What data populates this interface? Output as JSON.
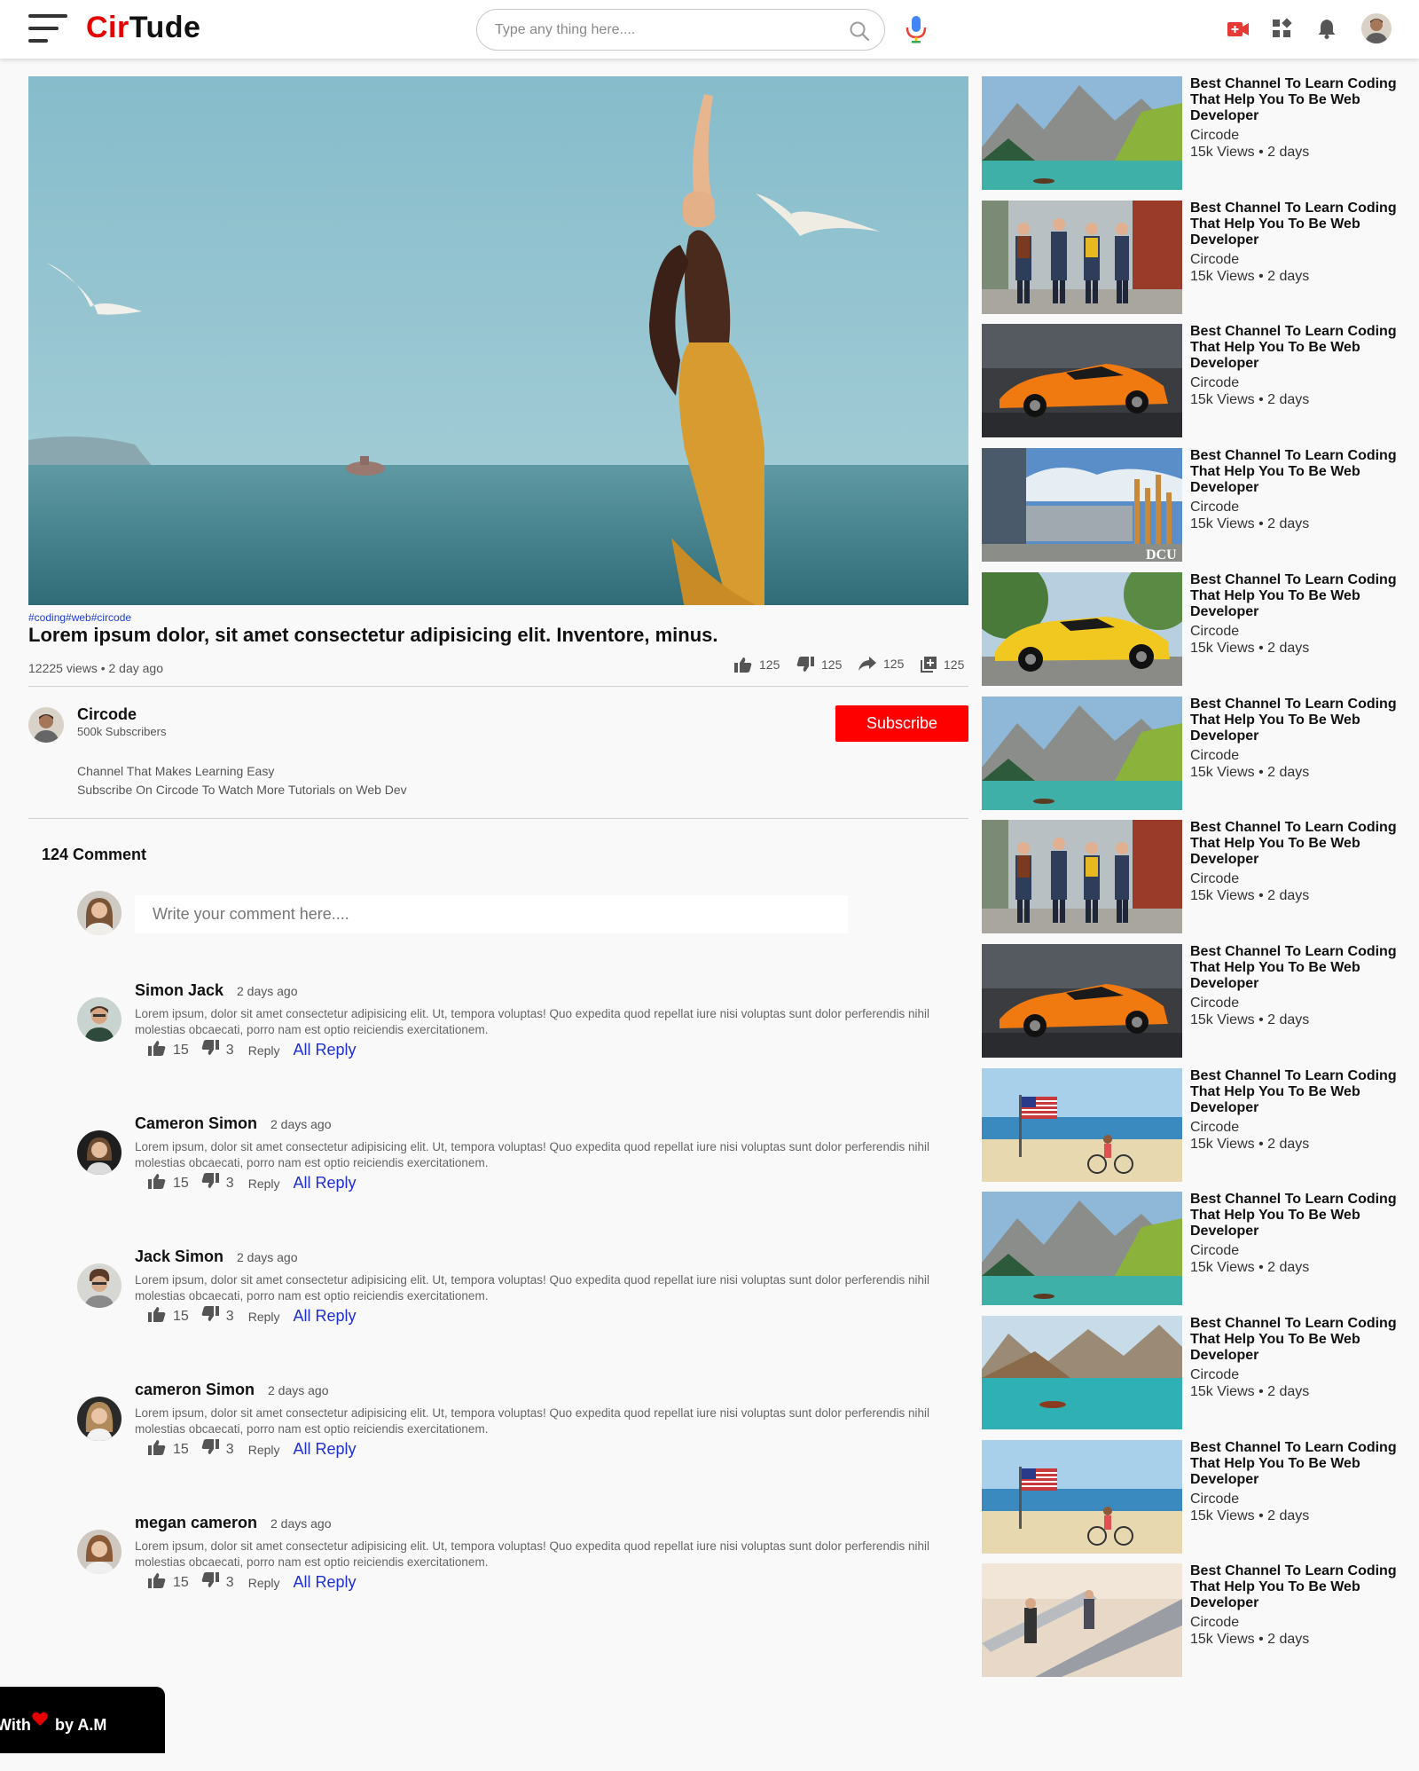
{
  "header": {
    "logo_part1": "Cir",
    "logo_part2": "Tude",
    "search_placeholder": "Type any thing here...."
  },
  "video": {
    "tags": "#coding#web#circode",
    "title": "Lorem ipsum dolor, sit amet consectetur adipisicing elit. Inventore, minus.",
    "meta": "12225 views • 2 day ago",
    "likes": "125",
    "dislikes": "125",
    "shares": "125",
    "saves": "125"
  },
  "channel": {
    "name": "Circode",
    "subscribers": "500k Subscribers",
    "subscribe_label": "Subscribe",
    "description_line1": "Channel That Makes Learning Easy",
    "description_line2": "Subscribe On Circode To Watch More Tutorials on Web Dev"
  },
  "comments_section": {
    "count_label": "124 Comment",
    "input_placeholder": "Write your comment here...."
  },
  "comments": [
    {
      "name": "Simon Jack",
      "time": "2 days ago",
      "text": "Lorem ipsum, dolor sit amet consectetur adipisicing elit. Ut, tempora voluptas! Quo expedita quod repellat iure nisi voluptas sunt dolor perferendis nihil molestias obcaecati, porro nam est optio reiciendis exercitationem.",
      "likes": "15",
      "dislikes": "3",
      "reply": "Reply",
      "all_reply": "All Reply"
    },
    {
      "name": "Cameron Simon",
      "time": "2 days ago",
      "text": "Lorem ipsum, dolor sit amet consectetur adipisicing elit. Ut, tempora voluptas! Quo expedita quod repellat iure nisi voluptas sunt dolor perferendis nihil molestias obcaecati, porro nam est optio reiciendis exercitationem.",
      "likes": "15",
      "dislikes": "3",
      "reply": "Reply",
      "all_reply": "All Reply"
    },
    {
      "name": "Jack Simon",
      "time": "2 days ago",
      "text": "Lorem ipsum, dolor sit amet consectetur adipisicing elit. Ut, tempora voluptas! Quo expedita quod repellat iure nisi voluptas sunt dolor perferendis nihil molestias obcaecati, porro nam est optio reiciendis exercitationem.",
      "likes": "15",
      "dislikes": "3",
      "reply": "Reply",
      "all_reply": "All Reply"
    },
    {
      "name": "cameron Simon",
      "time": "2 days ago",
      "text": "Lorem ipsum, dolor sit amet consectetur adipisicing elit. Ut, tempora voluptas! Quo expedita quod repellat iure nisi voluptas sunt dolor perferendis nihil molestias obcaecati, porro nam est optio reiciendis exercitationem.",
      "likes": "15",
      "dislikes": "3",
      "reply": "Reply",
      "all_reply": "All Reply"
    },
    {
      "name": "megan cameron",
      "time": "2 days ago",
      "text": "Lorem ipsum, dolor sit amet consectetur adipisicing elit. Ut, tempora voluptas! Quo expedita quod repellat iure nisi voluptas sunt dolor perferendis nihil molestias obcaecati, porro nam est optio reiciendis exercitationem.",
      "likes": "15",
      "dislikes": "3",
      "reply": "Reply",
      "all_reply": "All Reply"
    }
  ],
  "sidebar": [
    {
      "title": "Best Channel To Learn Coding That Help You To Be Web Developer",
      "channel": "Circode",
      "meta": "15k Views • 2 days",
      "thumb": "mountain-lake"
    },
    {
      "title": "Best Channel To Learn Coding That Help You To Be Web Developer",
      "channel": "Circode",
      "meta": "15k Views • 2 days",
      "thumb": "people-walking"
    },
    {
      "title": "Best Channel To Learn Coding That Help You To Be Web Developer",
      "channel": "Circode",
      "meta": "15k Views • 2 days",
      "thumb": "orange-car"
    },
    {
      "title": "Best Channel To Learn Coding That Help You To Be Web Developer",
      "channel": "Circode",
      "meta": "15k Views • 2 days",
      "thumb": "campus-building"
    },
    {
      "title": "Best Channel To Learn Coding That Help You To Be Web Developer",
      "channel": "Circode",
      "meta": "15k Views • 2 days",
      "thumb": "yellow-car"
    },
    {
      "title": "Best Channel To Learn Coding That Help You To Be Web Developer",
      "channel": "Circode",
      "meta": "15k Views • 2 days",
      "thumb": "mountain-lake"
    },
    {
      "title": "Best Channel To Learn Coding That Help You To Be Web Developer",
      "channel": "Circode",
      "meta": "15k Views • 2 days",
      "thumb": "people-walking"
    },
    {
      "title": "Best Channel To Learn Coding That Help You To Be Web Developer",
      "channel": "Circode",
      "meta": "15k Views • 2 days",
      "thumb": "orange-car"
    },
    {
      "title": "Best Channel To Learn Coding That Help You To Be Web Developer",
      "channel": "Circode",
      "meta": "15k Views • 2 days",
      "thumb": "beach-flag"
    },
    {
      "title": "Best Channel To Learn Coding That Help You To Be Web Developer",
      "channel": "Circode",
      "meta": "15k Views • 2 days",
      "thumb": "mountain-lake"
    },
    {
      "title": "Best Channel To Learn Coding That Help You To Be Web Developer",
      "channel": "Circode",
      "meta": "15k Views • 2 days",
      "thumb": "lake-boat"
    },
    {
      "title": "Best Channel To Learn Coding That Help You To Be Web Developer",
      "channel": "Circode",
      "meta": "15k Views • 2 days",
      "thumb": "beach-flag"
    },
    {
      "title": "Best Channel To Learn Coding That Help You To Be Web Developer",
      "channel": "Circode",
      "meta": "15k Views • 2 days",
      "thumb": "escalator"
    }
  ],
  "footer": {
    "with_text": "With",
    "by_text": "by A.M"
  },
  "colors": {
    "brand_red": "#e60000",
    "subscribe_red": "#ff0000",
    "link_blue": "#1f2fd6"
  }
}
